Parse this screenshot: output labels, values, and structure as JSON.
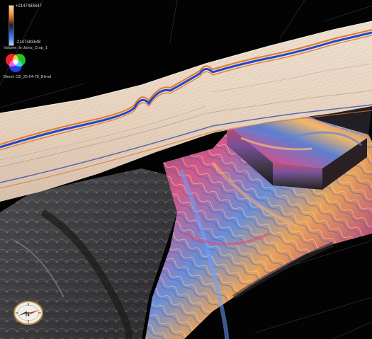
{
  "colorbar": {
    "max_label": "+2147483647",
    "min_label": "-2147483648"
  },
  "volume_label": "Volume: Is-Jarez_Crop_1",
  "blend_label": "Blend: CB_25-64-78_Blend",
  "compass": {
    "north_label": "N"
  },
  "colors": {
    "background": "#030304",
    "seismic_base": "#ecd8c4",
    "horizon_blue": "#2146c8",
    "horizon_orange": "#e07a2a"
  }
}
